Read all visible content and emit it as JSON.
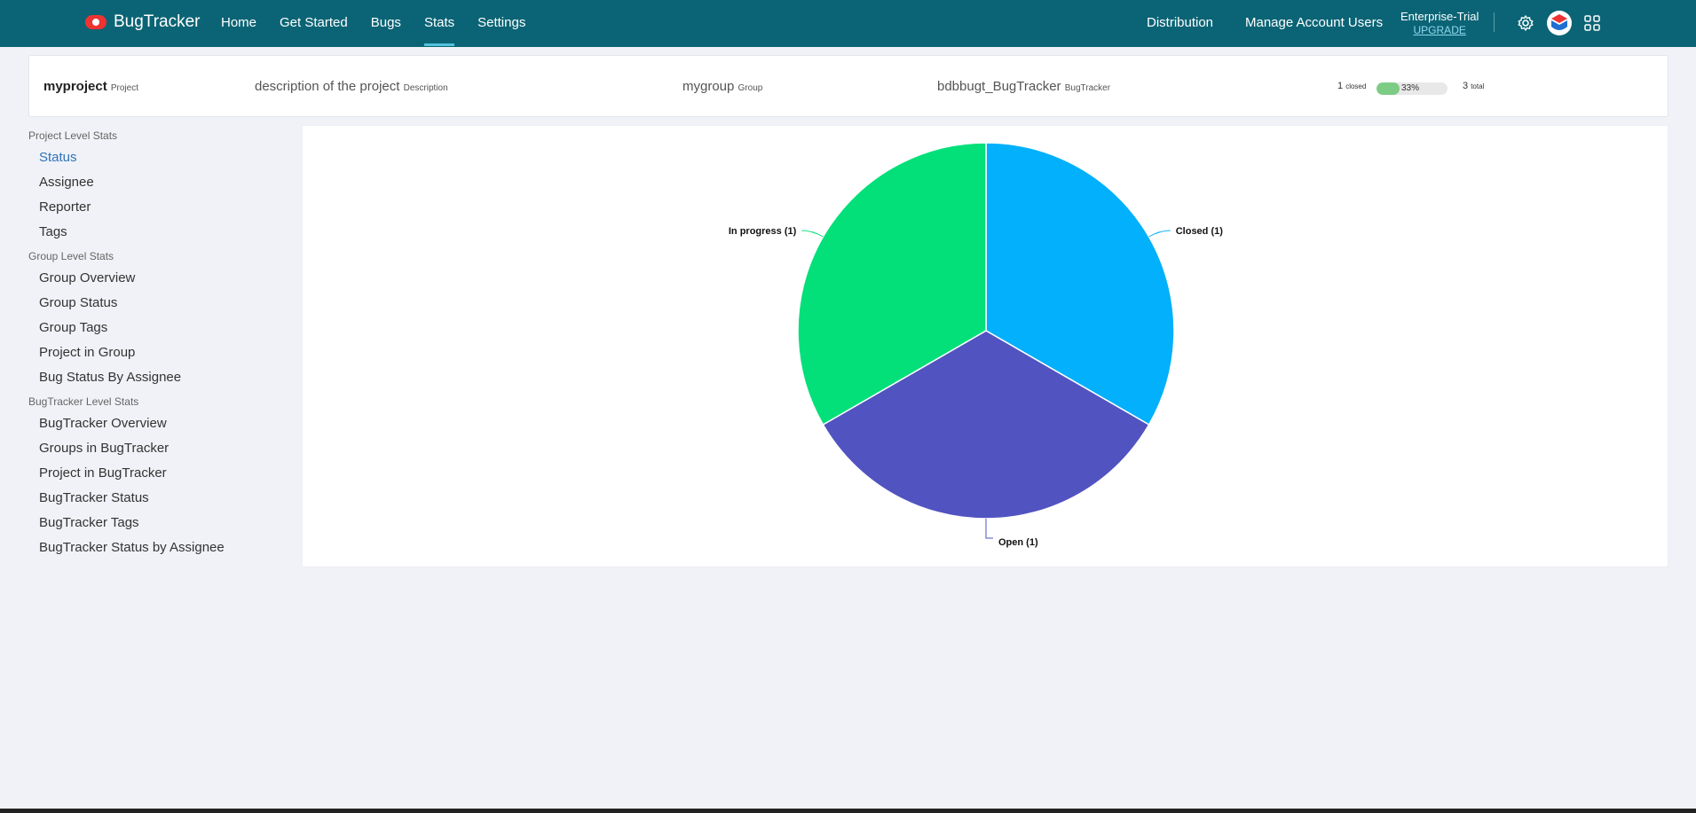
{
  "brand": {
    "name": "BugTracker",
    "accent": "#0b6475"
  },
  "nav": [
    {
      "label": "Home",
      "active": false
    },
    {
      "label": "Get Started",
      "active": false
    },
    {
      "label": "Bugs",
      "active": false
    },
    {
      "label": "Stats",
      "active": true
    },
    {
      "label": "Settings",
      "active": false
    }
  ],
  "right_nav": {
    "distribution": "Distribution",
    "manage_users": "Manage Account Users",
    "plan": "Enterprise-Trial",
    "upgrade": "UPGRADE",
    "icons": [
      "gear-icon",
      "account-logo-icon",
      "apps-grid-icon"
    ]
  },
  "project_info": {
    "project_name": "myproject",
    "project_tag": "Project",
    "description": "description of the project",
    "description_tag": "Description",
    "group": "mygroup",
    "group_tag": "Group",
    "tracker": "bdbbugt_BugTracker",
    "tracker_tag": "BugTracker",
    "closed_count": "1",
    "closed_tag": "closed",
    "progress_label": "33%",
    "progress_fraction": 0.33,
    "total_count": "3",
    "total_tag": "total"
  },
  "sidebar": {
    "sections": [
      {
        "title": "Project Level Stats",
        "items": [
          {
            "label": "Status",
            "active": true
          },
          {
            "label": "Assignee",
            "active": false
          },
          {
            "label": "Reporter",
            "active": false
          },
          {
            "label": "Tags",
            "active": false
          }
        ]
      },
      {
        "title": "Group Level Stats",
        "items": [
          {
            "label": "Group Overview",
            "active": false
          },
          {
            "label": "Group Status",
            "active": false
          },
          {
            "label": "Group Tags",
            "active": false
          },
          {
            "label": "Project in Group",
            "active": false
          },
          {
            "label": "Bug Status By Assignee",
            "active": false
          }
        ]
      },
      {
        "title": "BugTracker Level Stats",
        "items": [
          {
            "label": "BugTracker Overview",
            "active": false
          },
          {
            "label": "Groups in BugTracker",
            "active": false
          },
          {
            "label": "Project in BugTracker",
            "active": false
          },
          {
            "label": "BugTracker Status",
            "active": false
          },
          {
            "label": "BugTracker Tags",
            "active": false
          },
          {
            "label": "BugTracker Status by Assignee",
            "active": false
          }
        ]
      }
    ]
  },
  "chart_data": {
    "type": "pie",
    "title": "",
    "slices": [
      {
        "label": "Closed (1)",
        "value": 1,
        "color": "#03b0fb"
      },
      {
        "label": "Open (1)",
        "value": 1,
        "color": "#5153c0"
      },
      {
        "label": "In progress (1)",
        "value": 1,
        "color": "#03e07a"
      }
    ],
    "legend": "none"
  }
}
